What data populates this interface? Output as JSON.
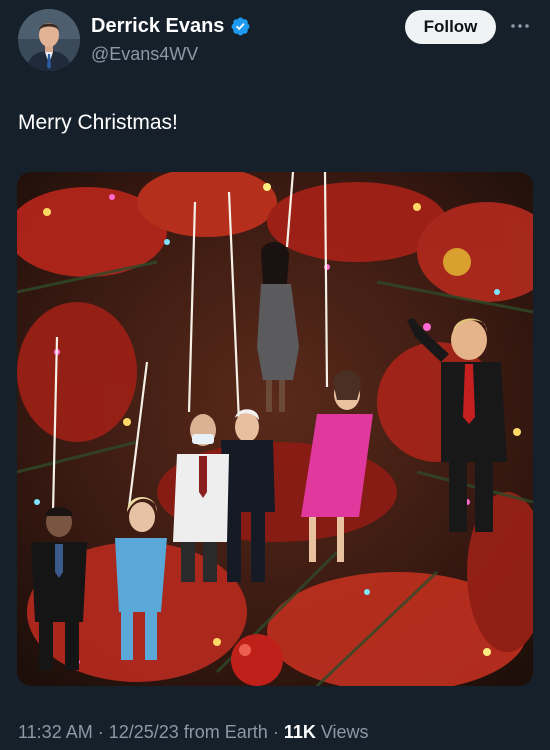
{
  "author": {
    "display_name": "Derrick Evans",
    "handle": "@Evans4WV",
    "verified": true,
    "avatar_icon": "profile-photo"
  },
  "actions": {
    "follow_label": "Follow",
    "more_icon": "more-horizontal-icon"
  },
  "tweet": {
    "text": "Merry Christmas!"
  },
  "media": {
    "description_icon": "christmas-tree-photo"
  },
  "meta": {
    "time": "11:32 AM",
    "date": "12/25/23",
    "source": "from Earth",
    "views_count": "11K",
    "views_label": "Views",
    "separator": "·"
  },
  "colors": {
    "background": "#15202b",
    "secondary_text": "#8b98a5",
    "verified_blue": "#1d9bf0",
    "follow_bg": "#eff3f4"
  }
}
